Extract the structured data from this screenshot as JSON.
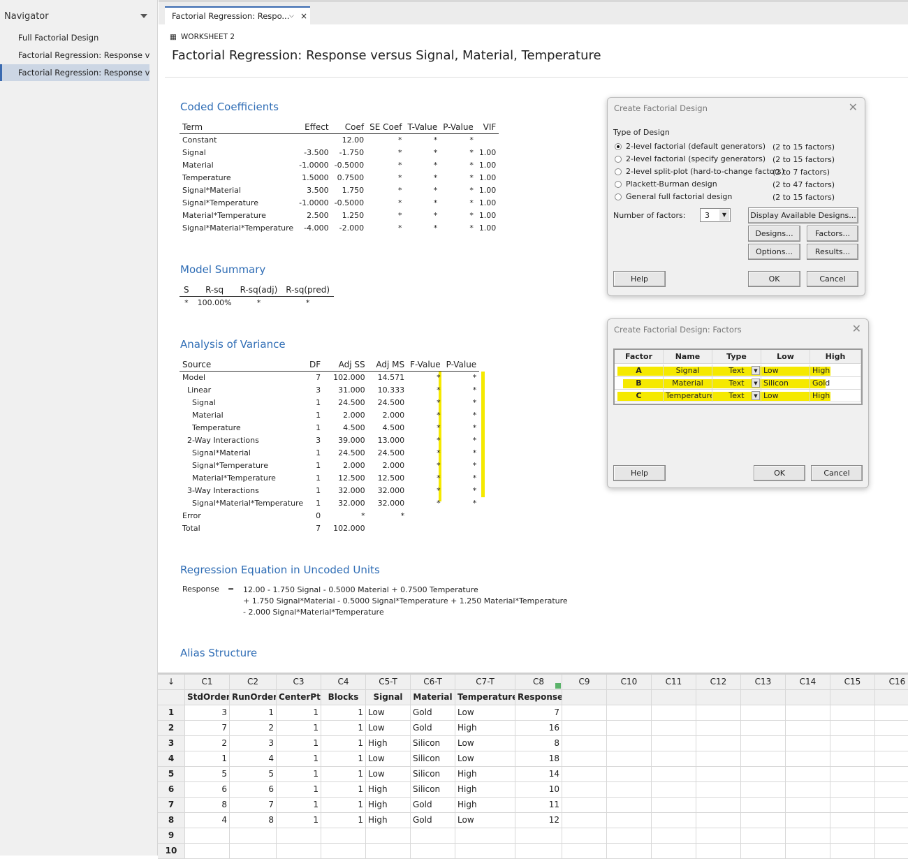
{
  "navigator": {
    "title": "Navigator",
    "items": [
      {
        "label": "Full Factorial Design"
      },
      {
        "label": "Factorial Regression: Response v..."
      },
      {
        "label": "Factorial Regression: Response v..."
      }
    ],
    "selected_index": 2
  },
  "tab": {
    "label": "Factorial Regression: Respo..."
  },
  "worksheet_label": "WORKSHEET 2",
  "page_title": "Factorial Regression: Response versus Signal, Material, Temperature",
  "coded": {
    "title": "Coded Coefficients",
    "headers": [
      "Term",
      "Effect",
      "Coef",
      "SE Coef",
      "T-Value",
      "P-Value",
      "VIF"
    ],
    "rows": [
      [
        "Constant",
        "",
        "12.00",
        "*",
        "*",
        "*",
        ""
      ],
      [
        "Signal",
        "-3.500",
        "-1.750",
        "*",
        "*",
        "*",
        "1.00"
      ],
      [
        "Material",
        "-1.0000",
        "-0.5000",
        "*",
        "*",
        "*",
        "1.00"
      ],
      [
        "Temperature",
        "1.5000",
        "0.7500",
        "*",
        "*",
        "*",
        "1.00"
      ],
      [
        "Signal*Material",
        "3.500",
        "1.750",
        "*",
        "*",
        "*",
        "1.00"
      ],
      [
        "Signal*Temperature",
        "-1.0000",
        "-0.5000",
        "*",
        "*",
        "*",
        "1.00"
      ],
      [
        "Material*Temperature",
        "2.500",
        "1.250",
        "*",
        "*",
        "*",
        "1.00"
      ],
      [
        "Signal*Material*Temperature",
        "-4.000",
        "-2.000",
        "*",
        "*",
        "*",
        "1.00"
      ]
    ]
  },
  "summary": {
    "title": "Model Summary",
    "headers": [
      "S",
      "R-sq",
      "R-sq(adj)",
      "R-sq(pred)"
    ],
    "rows": [
      [
        "*",
        "100.00%",
        "*",
        "*"
      ]
    ]
  },
  "anova": {
    "title": "Analysis of Variance",
    "headers": [
      "Source",
      "DF",
      "Adj SS",
      "Adj MS",
      "F-Value",
      "P-Value"
    ],
    "rows": [
      [
        "Model",
        "7",
        "102.000",
        "14.571",
        "*",
        "*"
      ],
      [
        "Linear",
        "3",
        "31.000",
        "10.333",
        "*",
        "*"
      ],
      [
        "Signal",
        "1",
        "24.500",
        "24.500",
        "*",
        "*"
      ],
      [
        "Material",
        "1",
        "2.000",
        "2.000",
        "*",
        "*"
      ],
      [
        "Temperature",
        "1",
        "4.500",
        "4.500",
        "*",
        "*"
      ],
      [
        "2-Way Interactions",
        "3",
        "39.000",
        "13.000",
        "*",
        "*"
      ],
      [
        "Signal*Material",
        "1",
        "24.500",
        "24.500",
        "*",
        "*"
      ],
      [
        "Signal*Temperature",
        "1",
        "2.000",
        "2.000",
        "*",
        "*"
      ],
      [
        "Material*Temperature",
        "1",
        "12.500",
        "12.500",
        "*",
        "*"
      ],
      [
        "3-Way Interactions",
        "1",
        "32.000",
        "32.000",
        "*",
        "*"
      ],
      [
        "Signal*Material*Temperature",
        "1",
        "32.000",
        "32.000",
        "*",
        "*"
      ],
      [
        "Error",
        "0",
        "*",
        "*",
        "",
        ""
      ],
      [
        "Total",
        "7",
        "102.000",
        "",
        "",
        ""
      ]
    ],
    "indent": [
      0,
      1,
      2,
      2,
      2,
      1,
      2,
      2,
      2,
      1,
      2,
      0,
      0
    ]
  },
  "equation": {
    "title": "Regression Equation in Uncoded Units",
    "lhs": "Response",
    "eq": "=",
    "lines": [
      "12.00 - 1.750 Signal - 0.5000 Material + 0.7500 Temperature",
      "+ 1.750 Signal*Material - 0.5000 Signal*Temperature + 1.250 Material*Temperature",
      "- 2.000 Signal*Material*Temperature"
    ]
  },
  "alias": {
    "title": "Alias Structure"
  },
  "dialog1": {
    "title": "Create Factorial Design",
    "type_label": "Type of Design",
    "options": [
      {
        "label": "2-level factorial (default generators)",
        "range": "(2 to 15 factors)",
        "selected": true
      },
      {
        "label": "2-level factorial (specify generators)",
        "range": "(2 to 15 factors)",
        "selected": false
      },
      {
        "label": "2-level split-plot (hard-to-change factors)",
        "range": "(2 to 7 factors)",
        "selected": false
      },
      {
        "label": "Plackett-Burman design",
        "range": "(2 to 47 factors)",
        "selected": false
      },
      {
        "label": "General full factorial design",
        "range": "(2 to 15 factors)",
        "selected": false
      }
    ],
    "num_factors_label": "Number of factors:",
    "num_factors": "3",
    "display_btn": "Display Available Designs...",
    "designs_btn": "Designs...",
    "factors_btn": "Factors...",
    "options_btn": "Options...",
    "results_btn": "Results...",
    "help_btn": "Help",
    "ok_btn": "OK",
    "cancel_btn": "Cancel"
  },
  "dialog2": {
    "title": "Create Factorial Design: Factors",
    "headers": [
      "Factor",
      "Name",
      "Type",
      "Low",
      "High"
    ],
    "rows": [
      [
        "A",
        "Signal",
        "Text",
        "Low",
        "High"
      ],
      [
        "B",
        "Material",
        "Text",
        "Silicon",
        "Gold"
      ],
      [
        "C",
        "Temperature",
        "Text",
        "Low",
        "High"
      ]
    ],
    "help_btn": "Help",
    "ok_btn": "OK",
    "cancel_btn": "Cancel",
    "highlight_color": "#f5e900"
  },
  "worksheet": {
    "columns": [
      "C1",
      "C2",
      "C3",
      "C4",
      "C5-T",
      "C6-T",
      "C7-T",
      "C8",
      "C9",
      "C10",
      "C11",
      "C12",
      "C13",
      "C14",
      "C15",
      "C16"
    ],
    "names": [
      "StdOrder",
      "RunOrder",
      "CenterPt",
      "Blocks",
      "Signal",
      "Material",
      "Temperature",
      "Response"
    ],
    "rows": [
      [
        "3",
        "1",
        "1",
        "1",
        "Low",
        "Gold",
        "Low",
        "7"
      ],
      [
        "7",
        "2",
        "1",
        "1",
        "Low",
        "Gold",
        "High",
        "16"
      ],
      [
        "2",
        "3",
        "1",
        "1",
        "High",
        "Silicon",
        "Low",
        "8"
      ],
      [
        "1",
        "4",
        "1",
        "1",
        "Low",
        "Silicon",
        "Low",
        "18"
      ],
      [
        "5",
        "5",
        "1",
        "1",
        "Low",
        "Silicon",
        "High",
        "14"
      ],
      [
        "6",
        "6",
        "1",
        "1",
        "High",
        "Silicon",
        "High",
        "10"
      ],
      [
        "8",
        "7",
        "1",
        "1",
        "High",
        "Gold",
        "High",
        "11"
      ],
      [
        "4",
        "8",
        "1",
        "1",
        "High",
        "Gold",
        "Low",
        "12"
      ]
    ],
    "row_numbers": [
      "1",
      "2",
      "3",
      "4",
      "5",
      "6",
      "7",
      "8",
      "9",
      "10"
    ],
    "arrow": "↓"
  }
}
